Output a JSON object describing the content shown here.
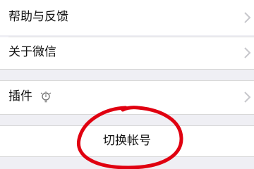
{
  "settings_group_1": {
    "items": [
      {
        "label": "帮助与反馈",
        "chevron_icon": "chevron-right-icon"
      },
      {
        "label": "关于微信",
        "chevron_icon": "chevron-right-icon"
      }
    ]
  },
  "settings_group_2": {
    "items": [
      {
        "label": "插件",
        "icon": "lightbulb-icon",
        "chevron_icon": "chevron-right-icon"
      }
    ]
  },
  "account": {
    "switch_label": "切换帐号"
  },
  "colors": {
    "background": "#efeff4",
    "row": "#ffffff",
    "annotation": "#e00010"
  }
}
